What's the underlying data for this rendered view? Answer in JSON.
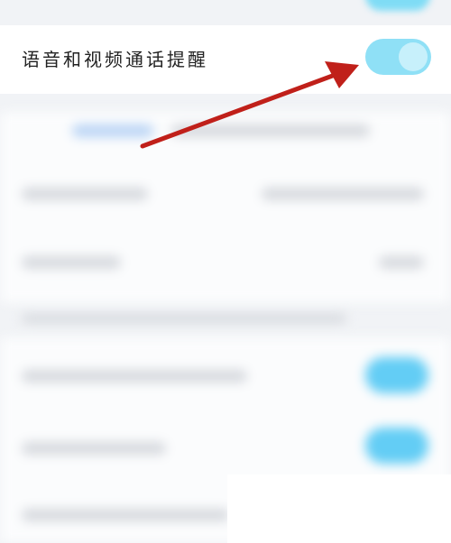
{
  "setting": {
    "label": "语音和视频通话提醒",
    "toggle_state": "on"
  },
  "colors": {
    "toggle_track": "#8fe0f6",
    "toggle_knob": "#c7f0fb",
    "annotation_arrow": "#c0201a",
    "blurred_toggle": "#63cdf5"
  },
  "annotation": {
    "type": "arrow",
    "points_to": "toggle"
  }
}
